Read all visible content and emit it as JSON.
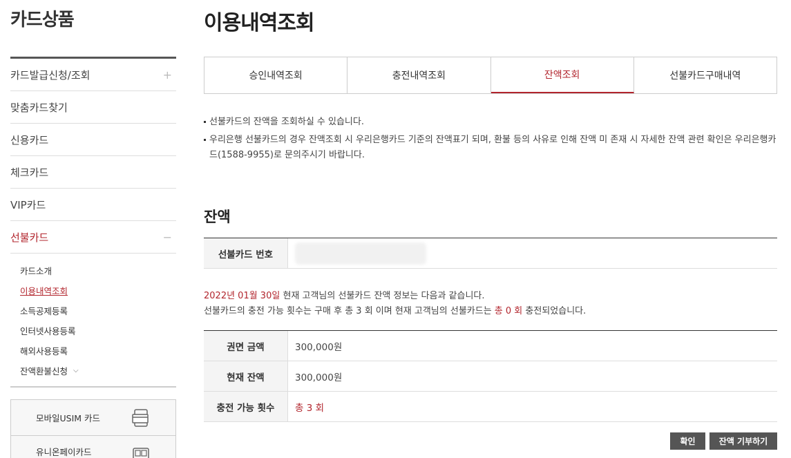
{
  "sidebar": {
    "title": "카드상품",
    "menu": [
      {
        "label": "카드발급신청/조회",
        "toggle": "+"
      },
      {
        "label": "맞춤카드찾기"
      },
      {
        "label": "신용카드"
      },
      {
        "label": "체크카드"
      },
      {
        "label": "VIP카드"
      },
      {
        "label": "선불카드",
        "toggle": "−"
      }
    ],
    "submenu": [
      {
        "label": "카드소개"
      },
      {
        "label": "이용내역조회"
      },
      {
        "label": "소득공제등록"
      },
      {
        "label": "인터넷사용등록"
      },
      {
        "label": "해외사용등록"
      },
      {
        "label": "잔액환불신청",
        "chevron": "⌵"
      }
    ],
    "banners": [
      {
        "label": "모바일USIM 카드",
        "icon": "usim-card-icon"
      },
      {
        "label": "유니온페이카드\n(은련카드)",
        "icon": "unionpay-card-icon"
      }
    ]
  },
  "main": {
    "title": "이용내역조회",
    "tabs": [
      {
        "label": "승인내역조회"
      },
      {
        "label": "충전내역조회"
      },
      {
        "label": "잔액조회"
      },
      {
        "label": "선불카드구매내역"
      }
    ],
    "notes": [
      "선불카드의 잔액을 조회하실 수 있습니다.",
      "우리은행 선불카드의 경우 잔액조회 시 우리은행카드 기준의 잔액표기 되며, 환불 등의 사유로 인해 잔액 미 존재 시 자세한 잔액 관련 확인은 우리은행카드(1588-9955)로 문의주시기 바랍니다."
    ],
    "section_title": "잔액",
    "card_number_label": "선불카드 번호",
    "info": {
      "date": "2022년 01월 30일",
      "line1_rest": " 현재 고객님의 선불카드 잔액 정보는 다음과 같습니다.",
      "line2_a": "선불카드의 충전 가능 횟수는 구매 후 총 3 회 이며 현재 고객님의 선불카드는 ",
      "line2_count": "총 0 회",
      "line2_b": " 충전되었습니다."
    },
    "balance_rows": [
      {
        "label": "권면 금액",
        "value": "300,000원"
      },
      {
        "label": "현재 잔액",
        "value": "300,000원"
      },
      {
        "label": "충전 가능 횟수",
        "value": "총 3 회"
      }
    ],
    "buttons": {
      "confirm": "확인",
      "donate": "잔액 기부하기"
    }
  },
  "colors": {
    "accent": "#b2252d",
    "button": "#555555"
  }
}
